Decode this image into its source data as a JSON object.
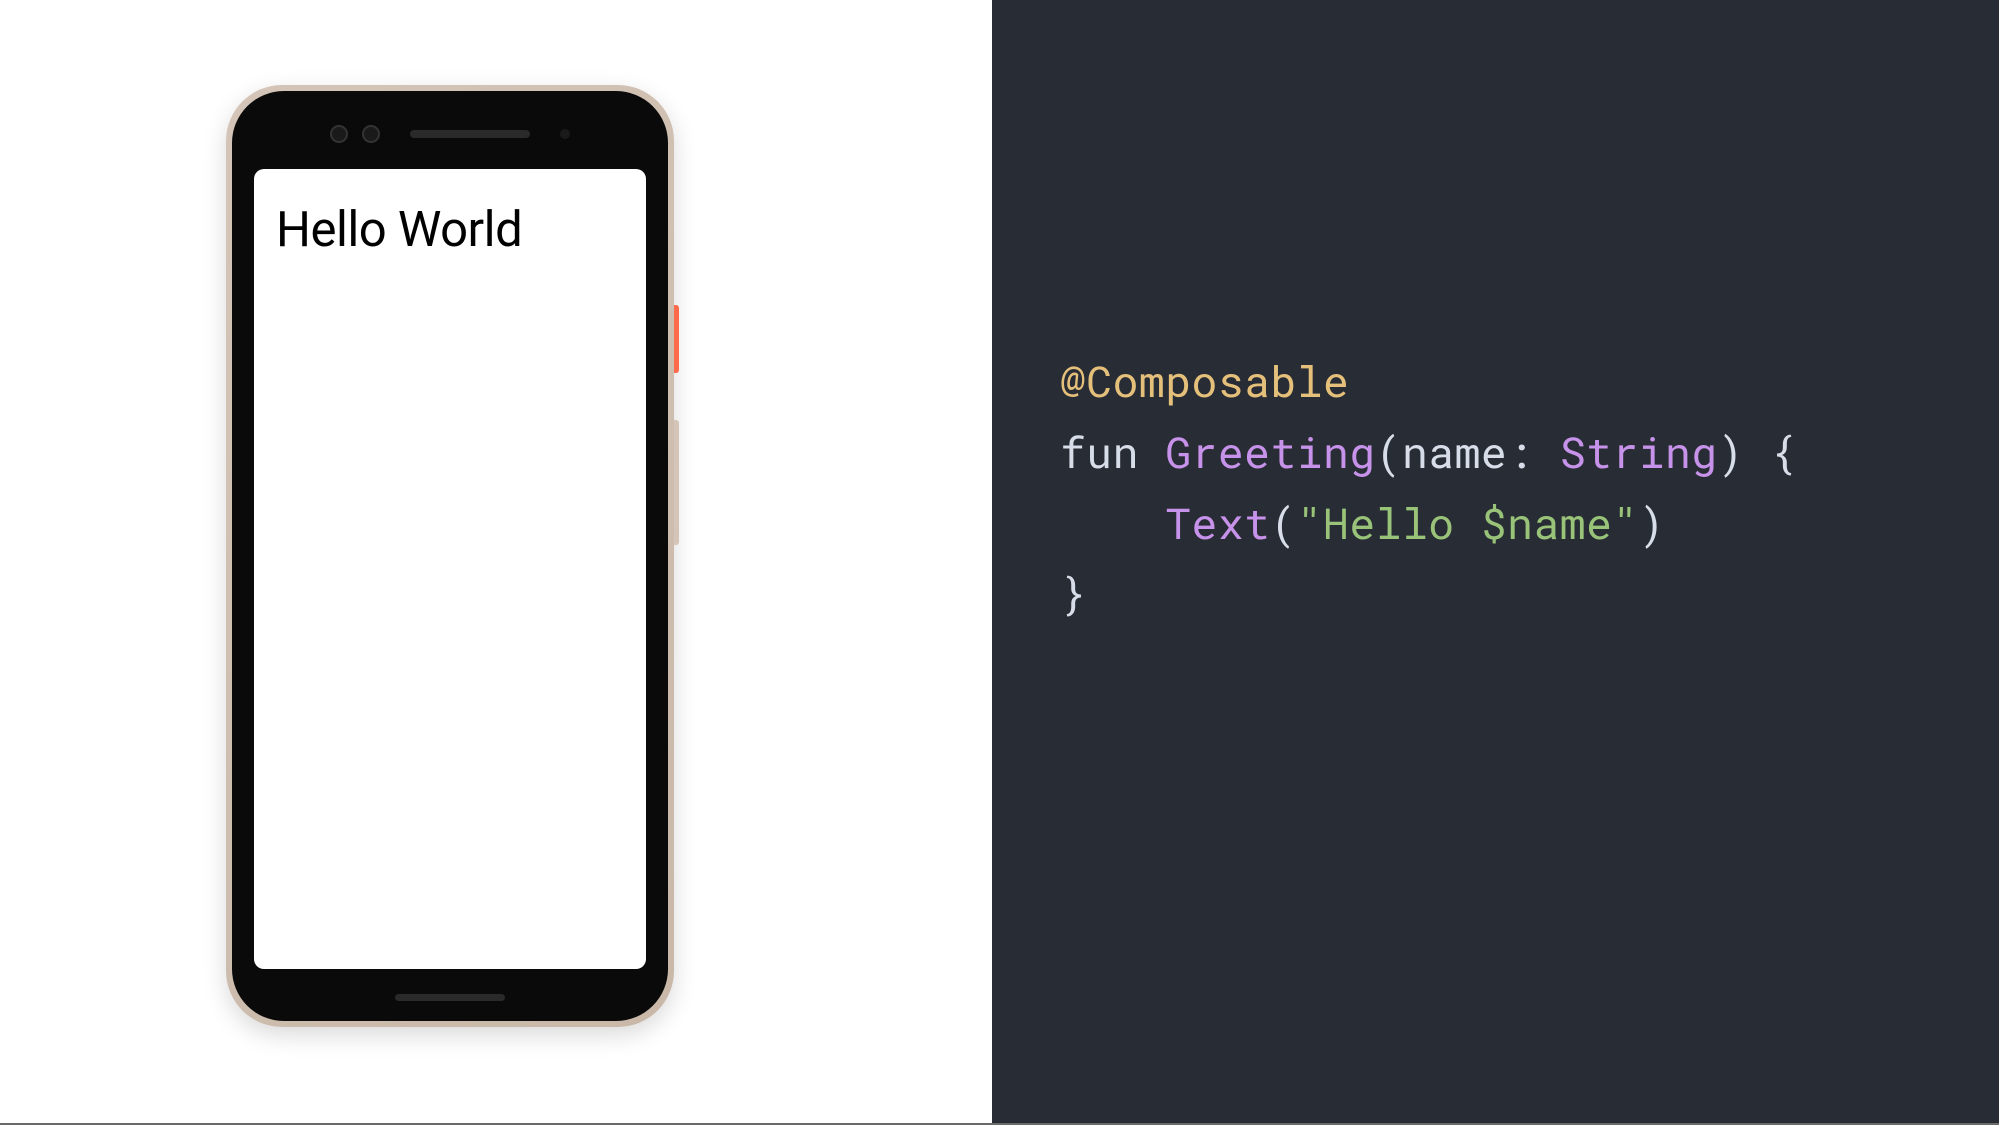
{
  "phone": {
    "screen_text": "Hello World"
  },
  "code": {
    "annotation": "@Composable",
    "keyword_fun": "fun",
    "function_name": "Greeting",
    "paren_open": "(",
    "param_name": "name",
    "colon": ":",
    "space": " ",
    "param_type": "String",
    "paren_close": ")",
    "brace_open": " {",
    "indent": "    ",
    "call_name": "Text",
    "call_paren_open": "(",
    "string_literal": "\"Hello $name\"",
    "call_paren_close": ")",
    "brace_close": "}"
  },
  "colors": {
    "code_bg": "#282c34",
    "annotation": "#e5c07b",
    "purple": "#c792ea",
    "string": "#98c379",
    "default": "#d8dee9"
  }
}
